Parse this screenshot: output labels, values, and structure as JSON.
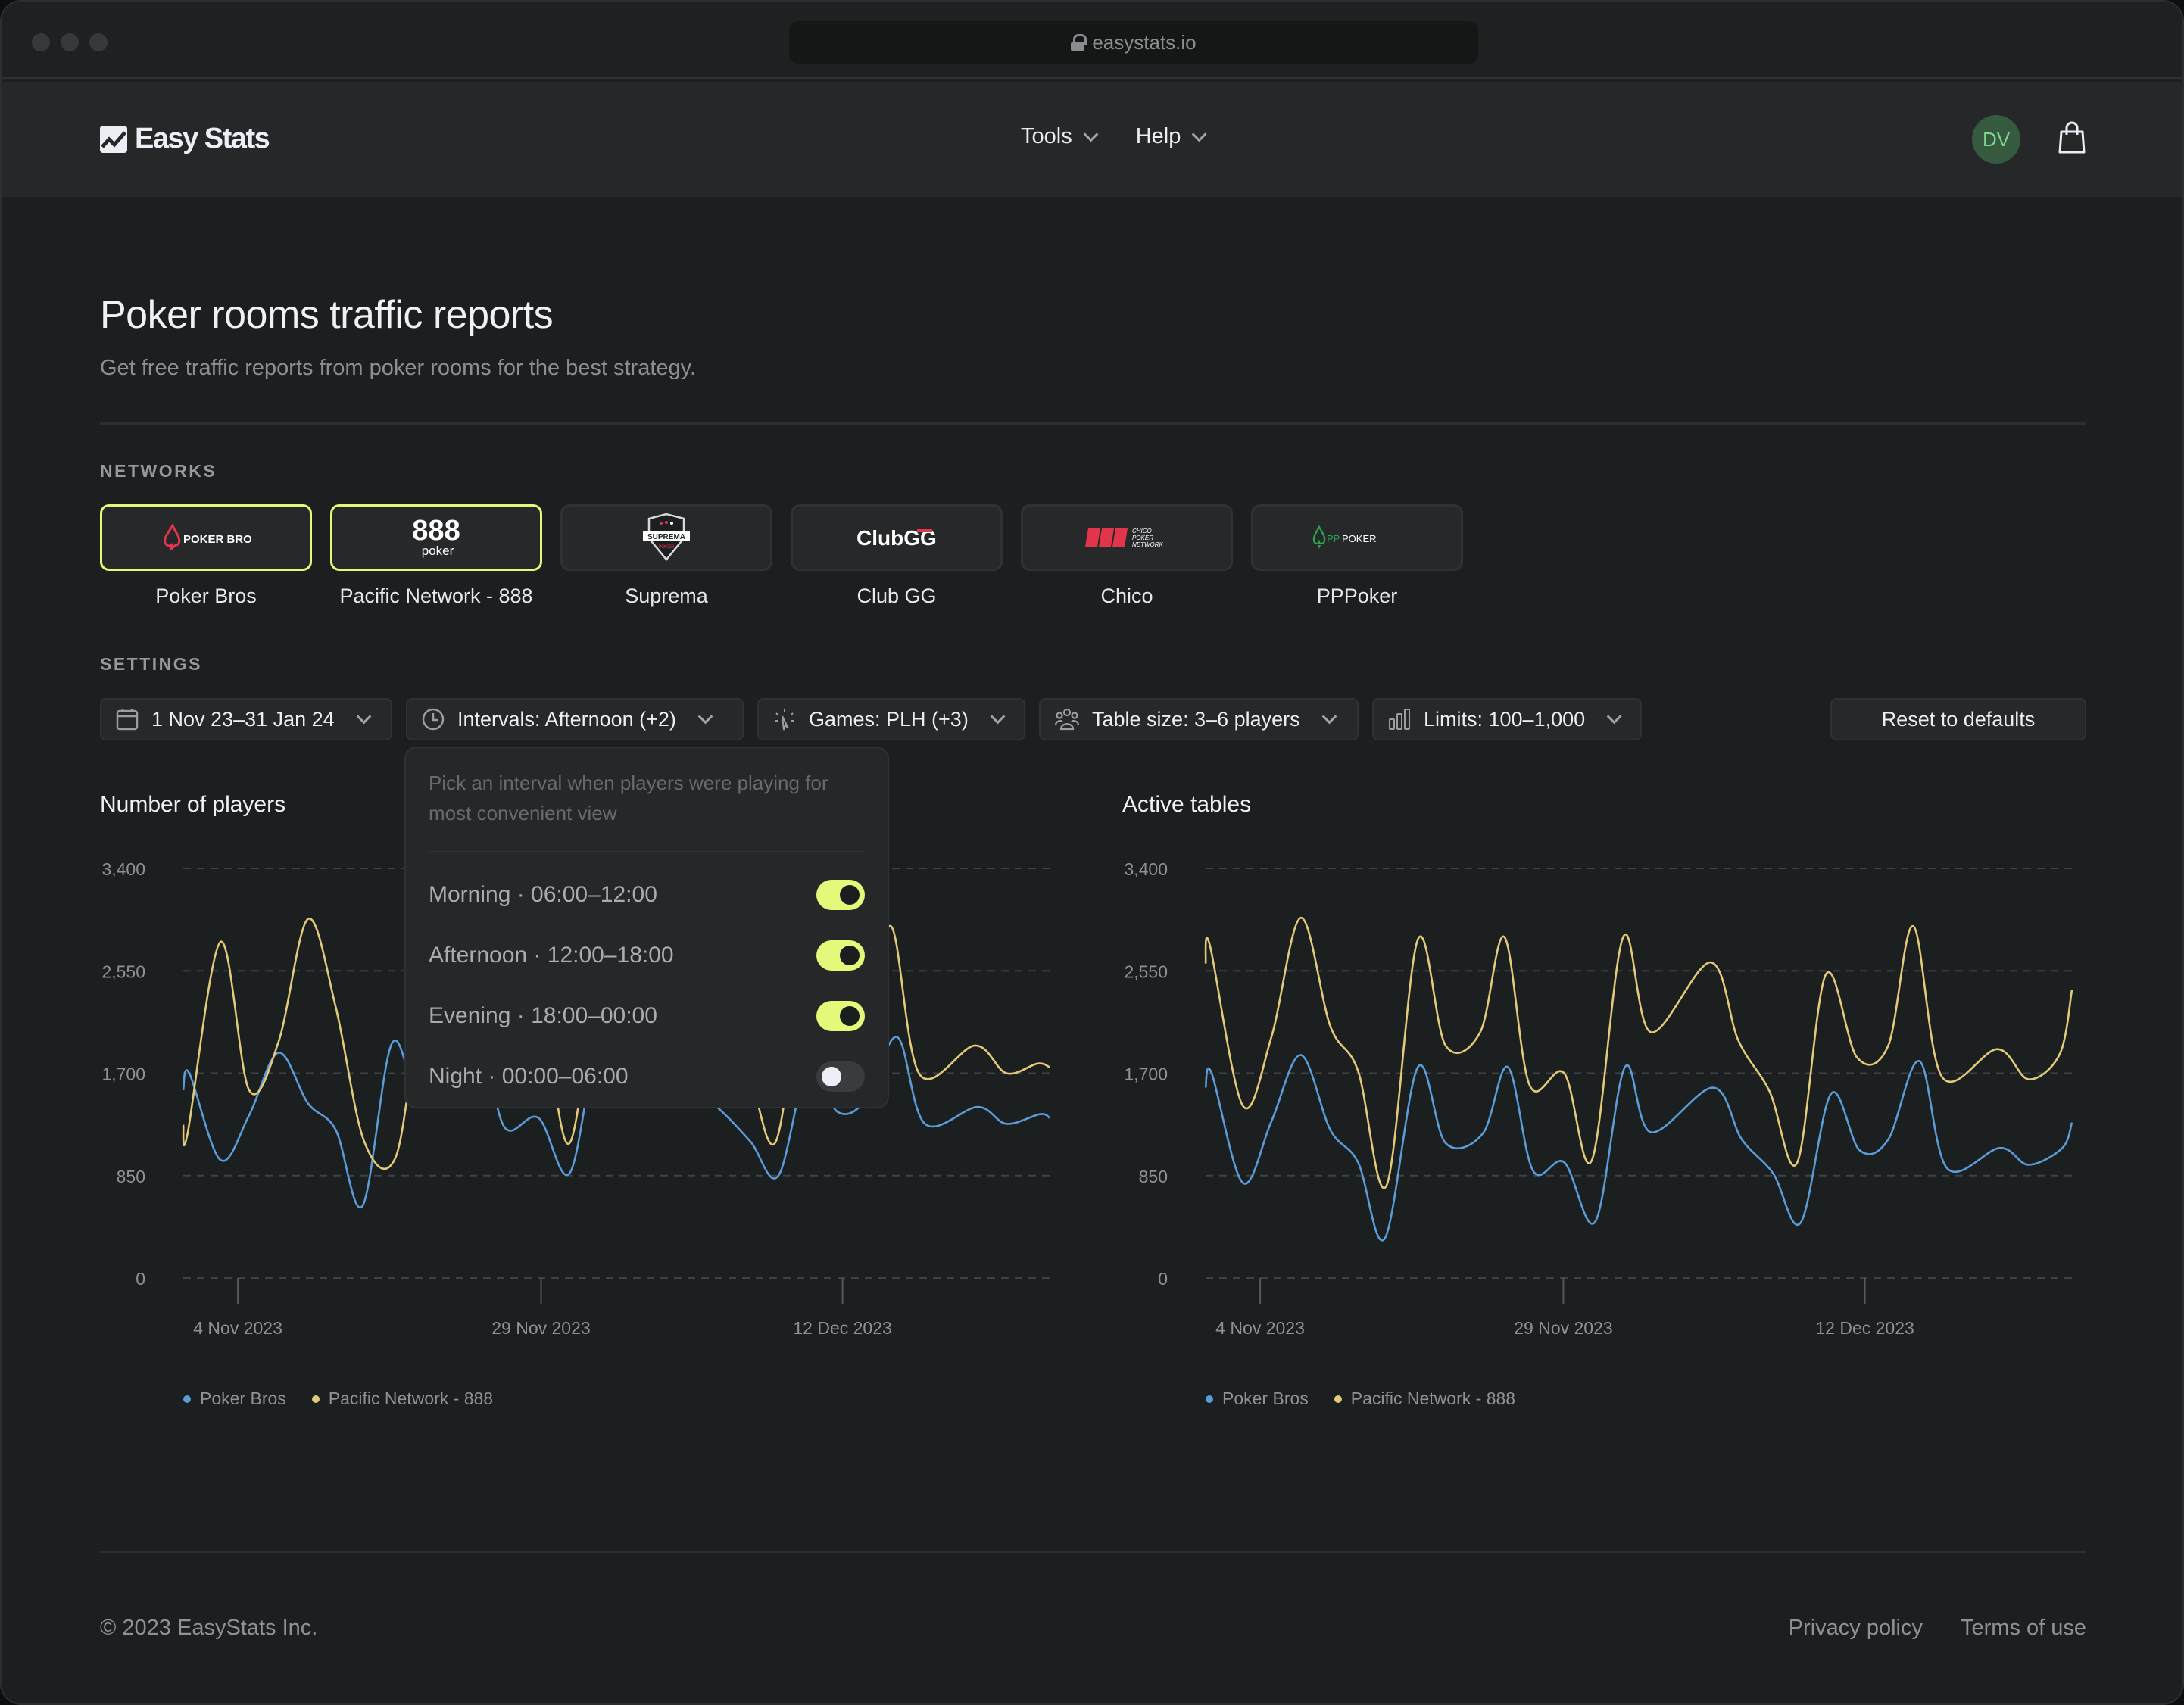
{
  "browser": {
    "url": "easystats.io"
  },
  "header": {
    "brand": "Easy Stats",
    "menu": [
      {
        "label": "Tools"
      },
      {
        "label": "Help"
      }
    ],
    "avatar_initials": "DV"
  },
  "page": {
    "title": "Poker rooms traffic reports",
    "subtitle": "Get free traffic reports from poker rooms for the best strategy."
  },
  "networks": {
    "label": "NETWORKS",
    "items": [
      {
        "name": "Poker Bros",
        "logo_text": "POKER BROS",
        "selected": true
      },
      {
        "name": "Pacific Network - 888",
        "logo_text": "888 poker",
        "selected": true
      },
      {
        "name": "Suprema",
        "logo_text": "SUPREMA",
        "selected": false
      },
      {
        "name": "Club GG",
        "logo_text": "ClubGG",
        "selected": false
      },
      {
        "name": "Chico",
        "logo_text": "CHICO POKER NETWORK",
        "selected": false
      },
      {
        "name": "PPPoker",
        "logo_text": "PPPOKER",
        "selected": false
      }
    ]
  },
  "settings": {
    "label": "SETTINGS",
    "filters": [
      {
        "icon": "calendar-icon",
        "label": "1 Nov 23–31 Jan 24"
      },
      {
        "icon": "clock-icon",
        "label": "Intervals: Afternoon (+2)"
      },
      {
        "icon": "cursor-click-icon",
        "label": "Games: PLH (+3)"
      },
      {
        "icon": "users-icon",
        "label": "Table size: 3–6 players"
      },
      {
        "icon": "bar-chart-icon",
        "label": "Limits: 100–1,000"
      }
    ],
    "reset_label": "Reset to defaults"
  },
  "intervals_popover": {
    "description": "Pick an interval when players were playing for most convenient view",
    "options": [
      {
        "label": "Morning · 06:00–12:00",
        "enabled": true
      },
      {
        "label": "Afternoon · 12:00–18:00",
        "enabled": true
      },
      {
        "label": "Evening · 18:00–00:00",
        "enabled": true
      },
      {
        "label": "Night · 00:00–06:00",
        "enabled": false
      }
    ]
  },
  "colors": {
    "accent": "#e4f97a",
    "series_poker_bros": "#5b9bd8",
    "series_pacific": "#e3c97a"
  },
  "chart_data": [
    {
      "type": "line",
      "title": "Number of players",
      "xlabel": "",
      "ylabel": "",
      "ylim": [
        0,
        3400
      ],
      "yticks": [
        "3,400",
        "2,550",
        "1,700",
        "850",
        "0"
      ],
      "ytick_values": [
        3400,
        2550,
        1700,
        850,
        0
      ],
      "xticks": [
        {
          "label": "4 Nov 2023",
          "t": 6.3
        },
        {
          "label": "29 Nov 2023",
          "t": 41.3
        },
        {
          "label": "12 Dec 2023",
          "t": 76.1
        }
      ],
      "x_axis_note": "t = position along the time axis, 0–100",
      "grid": true,
      "legend": "bottom-left",
      "series": [
        {
          "name": "Poker Bros",
          "color": "#5b9bd8",
          "t": [
            0,
            0.7,
            4.3,
            7.6,
            11.0,
            14.4,
            17.6,
            20.7,
            24.1,
            27.3,
            31.3,
            34.2,
            37.1,
            41.0,
            44.6,
            48.0,
            51.0,
            57.5,
            61.9,
            65.5,
            68.7,
            72.2,
            75.5,
            78.8,
            82.4,
            85.6,
            91.7,
            95.0,
            98.9,
            100
          ],
          "values": [
            1560,
            1700,
            980,
            1350,
            1870,
            1450,
            1230,
            600,
            1950,
            1450,
            1540,
            1980,
            1250,
            1330,
            870,
            1980,
            1480,
            1650,
            1400,
            1130,
            850,
            1780,
            1380,
            1480,
            2000,
            1280,
            1420,
            1280,
            1360,
            1330
          ]
        },
        {
          "name": "Pacific Network - 888",
          "color": "#e3c97a",
          "t": [
            0,
            0.5,
            4.3,
            7.6,
            11.0,
            14.4,
            17.6,
            20.9,
            24.5,
            27.7,
            31.7,
            34.5,
            37.4,
            41.4,
            44.6,
            48.2,
            51.4,
            58.2,
            61.5,
            65.1,
            68.3,
            71.6,
            75.2,
            78.8,
            81.7,
            85.0,
            91.4,
            95.0,
            98.6,
            100
          ],
          "values": [
            1270,
            1200,
            2790,
            1560,
            1960,
            2980,
            2250,
            1130,
            1000,
            2230,
            2050,
            2630,
            2110,
            2110,
            1120,
            2670,
            2470,
            2450,
            2110,
            1750,
            1120,
            2400,
            2130,
            2040,
            2920,
            1690,
            1930,
            1700,
            1780,
            1750
          ]
        }
      ]
    },
    {
      "type": "line",
      "title": "Active tables",
      "xlabel": "",
      "ylabel": "",
      "ylim": [
        0,
        3400
      ],
      "yticks": [
        "3,400",
        "2,550",
        "1,700",
        "850",
        "0"
      ],
      "ytick_values": [
        3400,
        2550,
        1700,
        850,
        0
      ],
      "xticks": [
        {
          "label": "4 Nov 2023",
          "t": 6.3
        },
        {
          "label": "29 Nov 2023",
          "t": 41.3
        },
        {
          "label": "12 Dec 2023",
          "t": 76.1
        }
      ],
      "grid": true,
      "legend": "bottom-left",
      "series": [
        {
          "name": "Poker Bros",
          "color": "#5b9bd8",
          "t": [
            0,
            0.7,
            4.3,
            7.6,
            11.0,
            14.4,
            17.6,
            20.7,
            24.5,
            27.7,
            32.0,
            34.9,
            37.8,
            41.4,
            45.0,
            48.4,
            51.4,
            58.6,
            61.9,
            65.5,
            68.7,
            72.2,
            75.5,
            78.8,
            82.4,
            85.6,
            91.7,
            95.0,
            98.9,
            100
          ],
          "values": [
            1580,
            1700,
            790,
            1300,
            1850,
            1230,
            960,
            330,
            1750,
            1120,
            1200,
            1750,
            890,
            960,
            470,
            1750,
            1210,
            1580,
            1150,
            870,
            460,
            1530,
            1060,
            1150,
            1800,
            910,
            1080,
            940,
            1080,
            1290
          ]
        },
        {
          "name": "Pacific Network - 888",
          "color": "#e3c97a",
          "t": [
            0,
            0.5,
            4.3,
            7.6,
            11.0,
            14.4,
            17.6,
            20.9,
            24.5,
            27.7,
            31.7,
            34.5,
            37.4,
            41.4,
            44.6,
            48.2,
            51.4,
            58.3,
            61.5,
            65.1,
            68.3,
            71.6,
            75.2,
            78.8,
            81.7,
            85.0,
            91.4,
            95.0,
            98.6,
            100
          ],
          "values": [
            2610,
            2760,
            1430,
            2000,
            2990,
            2090,
            1720,
            770,
            2810,
            1930,
            2040,
            2830,
            1600,
            1700,
            980,
            2830,
            2040,
            2620,
            1970,
            1550,
            960,
            2520,
            1830,
            1930,
            2920,
            1670,
            1900,
            1650,
            1860,
            2390
          ]
        }
      ]
    }
  ],
  "footer": {
    "copyright": "© 2023 EasyStats Inc.",
    "links": [
      {
        "label": "Privacy policy"
      },
      {
        "label": "Terms of use"
      }
    ]
  }
}
